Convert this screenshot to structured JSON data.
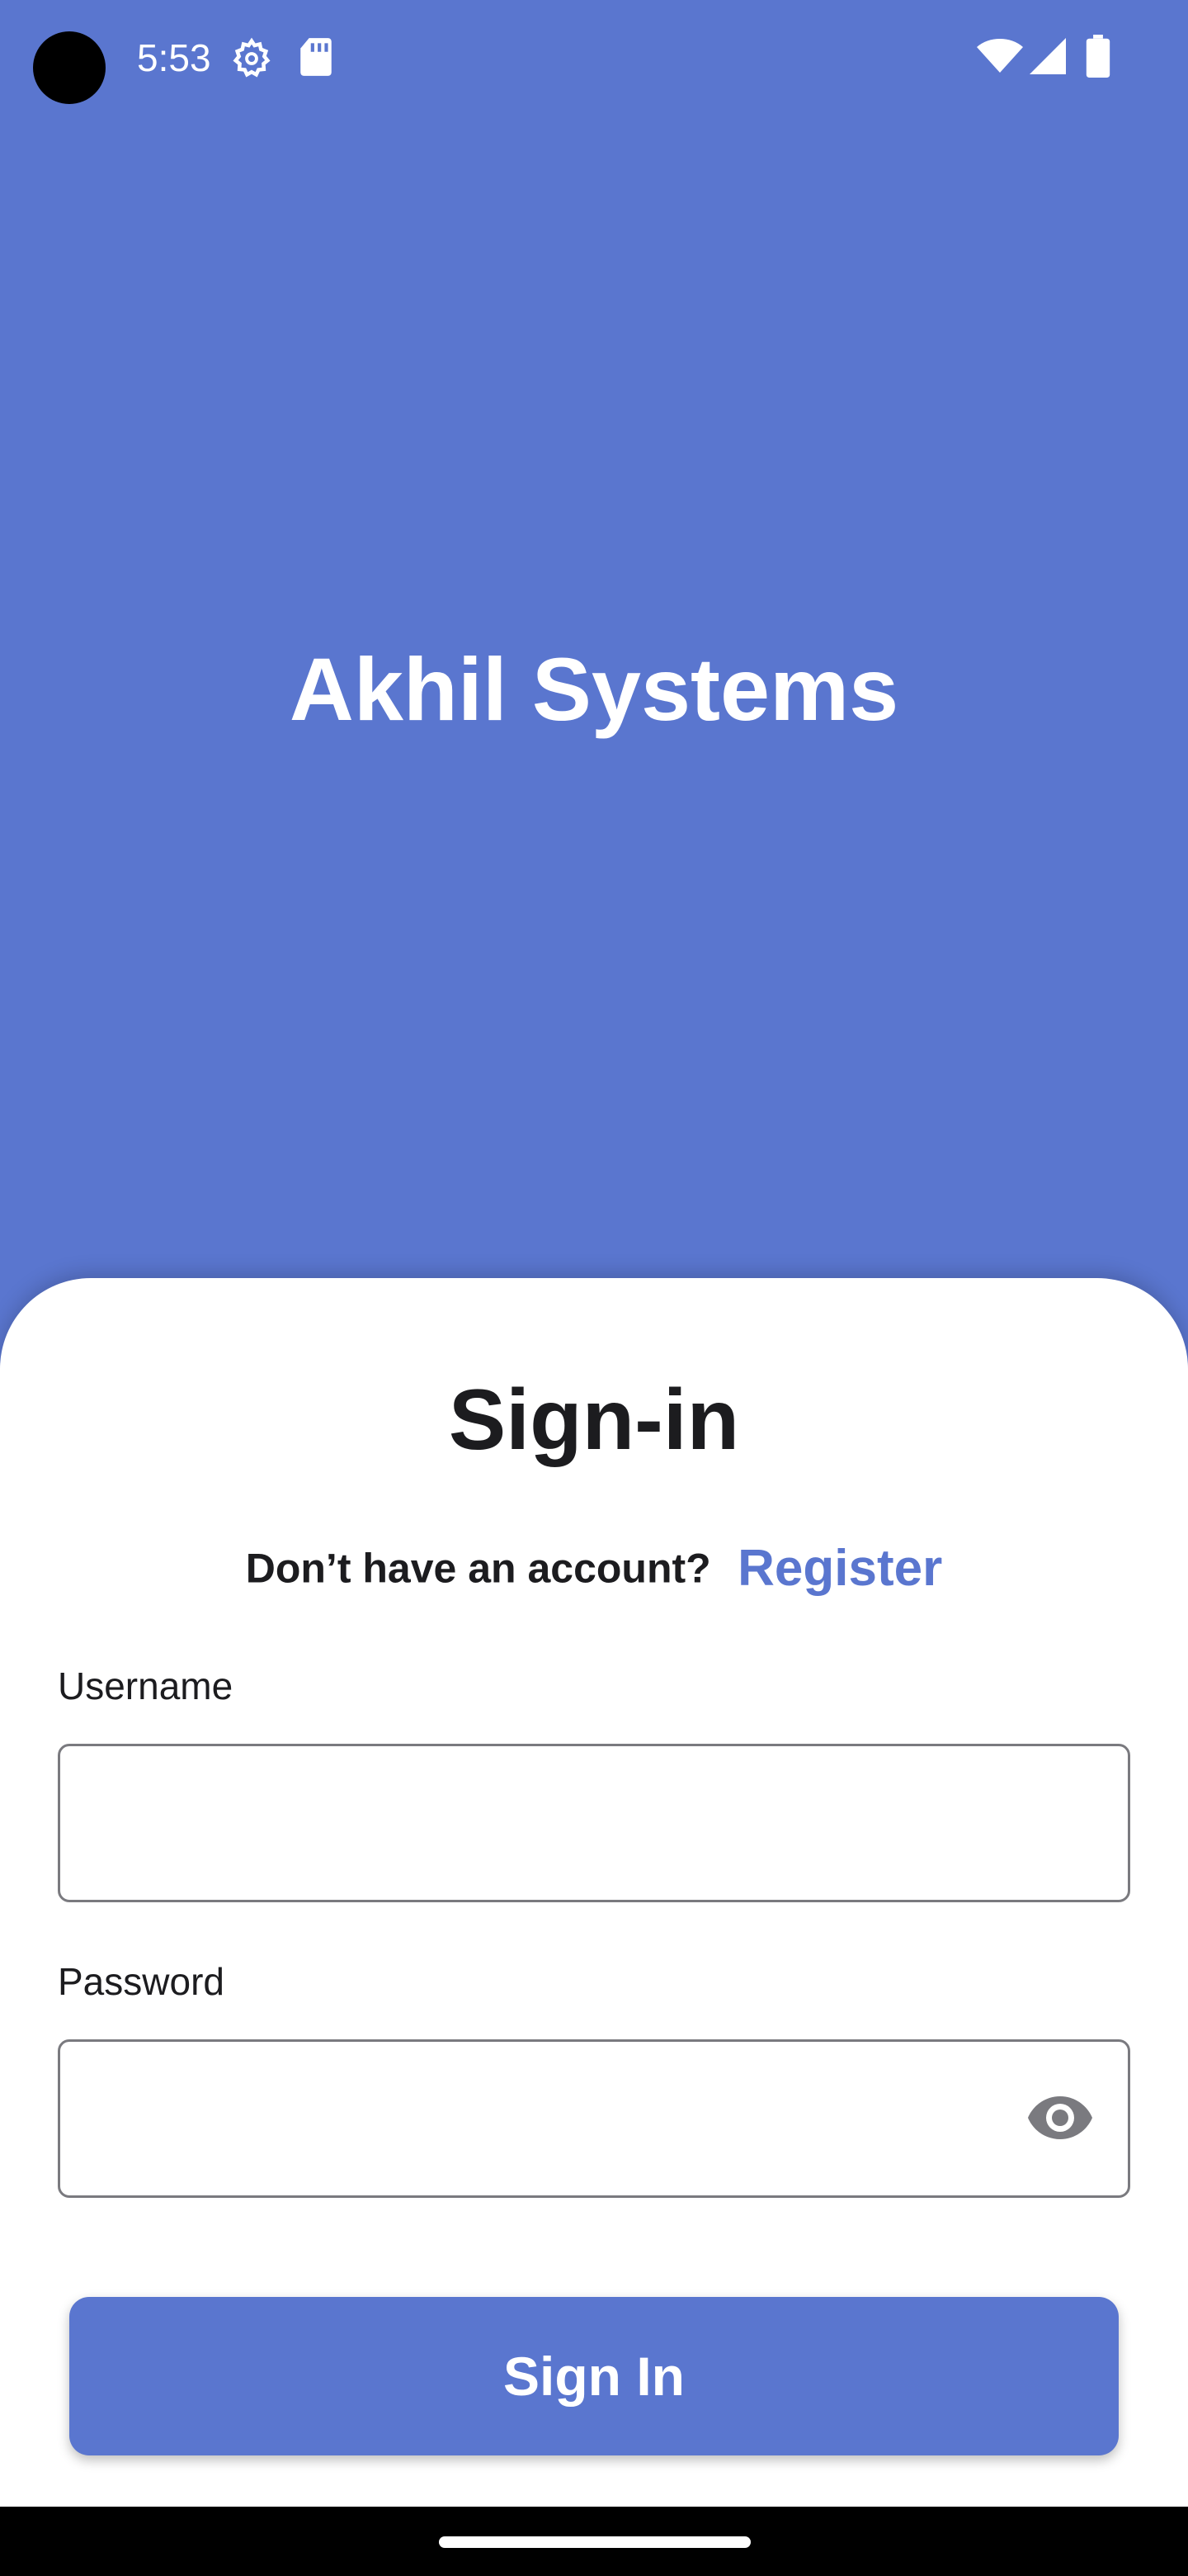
{
  "status_bar": {
    "time": "5:53",
    "icons": [
      "gear-icon",
      "sd-card-icon",
      "wifi-icon",
      "signal-icon",
      "battery-icon"
    ]
  },
  "app": {
    "title": "Akhil Systems",
    "accent_color": "#5a76cf"
  },
  "sheet": {
    "title": "Sign-in",
    "register_prompt": "Don’t have an account?",
    "register_link": "Register",
    "username": {
      "label": "Username",
      "value": "",
      "placeholder": ""
    },
    "password": {
      "label": "Password",
      "value": "",
      "placeholder": "",
      "toggle_icon": "eye-icon"
    },
    "submit_label": "Sign In"
  }
}
